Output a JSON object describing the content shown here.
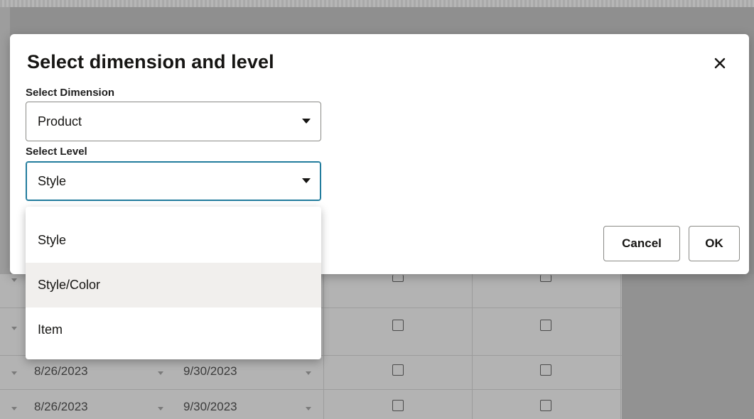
{
  "dialog": {
    "title": "Select dimension and level",
    "close_icon": "close-icon",
    "dimension_label": "Select Dimension",
    "dimension_value": "Product",
    "level_label": "Select Level",
    "level_value": "Style",
    "cancel_label": "Cancel",
    "ok_label": "OK"
  },
  "level_options": [
    {
      "label": "Style"
    },
    {
      "label": "Style/Color"
    },
    {
      "label": "Item"
    }
  ],
  "background_rows": [
    {
      "start": "8/26/2023",
      "end": "9/30/2023"
    },
    {
      "start": "8/26/2023",
      "end": "9/30/2023"
    }
  ],
  "colors": {
    "accent_focus": "#227c9d",
    "overlay": "#8f8f8f"
  }
}
